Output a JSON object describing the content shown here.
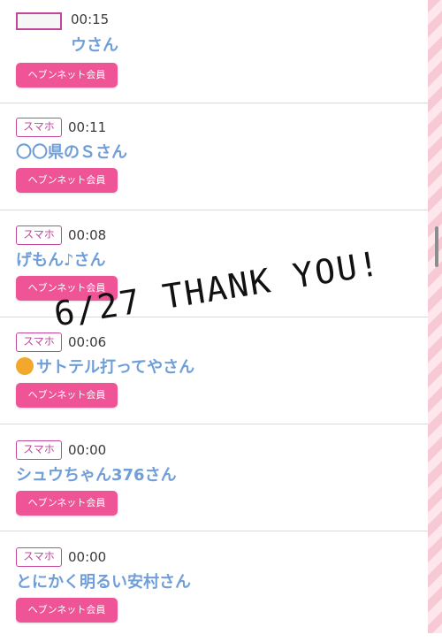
{
  "entries": [
    {
      "device": "",
      "time": "00:15",
      "name": "ウさん",
      "member_label": "ヘブンネット会員"
    },
    {
      "device": "スマホ",
      "time": "00:11",
      "name": "〇〇県のＳさん",
      "member_label": "ヘブンネット会員"
    },
    {
      "device": "スマホ",
      "time": "00:08",
      "name": "げもん♪さん",
      "member_label": "ヘブンネット会員"
    },
    {
      "device": "スマホ",
      "time": "00:06",
      "name": "サトテル打ってやさん",
      "member_label": "ヘブンネット会員"
    },
    {
      "device": "スマホ",
      "time": "00:00",
      "name": "シュウちゃん376さん",
      "member_label": "ヘブンネット会員"
    },
    {
      "device": "スマホ",
      "time": "00:00",
      "name": "とにかく明るい安村さん",
      "member_label": "ヘブンネット会員"
    }
  ],
  "overlay": {
    "text": "6/27 THANK YOU!"
  },
  "colors": {
    "accent_pink": "#ef5497",
    "badge_magenta": "#c2479c",
    "name_blue": "#6f9ed8"
  }
}
